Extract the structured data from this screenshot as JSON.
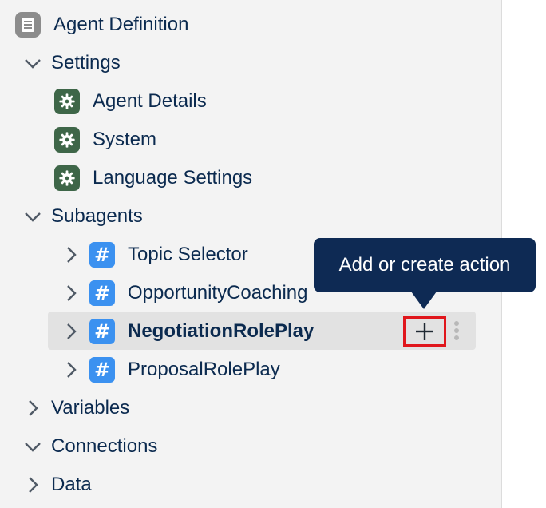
{
  "tree": {
    "agent_definition": "Agent Definition",
    "settings": {
      "label": "Settings",
      "items": [
        {
          "label": "Agent Details"
        },
        {
          "label": "System"
        },
        {
          "label": "Language Settings"
        }
      ]
    },
    "subagents": {
      "label": "Subagents",
      "items": [
        {
          "label": "Topic Selector"
        },
        {
          "label": "OpportunityCoaching"
        },
        {
          "label": "NegotiationRolePlay"
        },
        {
          "label": "ProposalRolePlay"
        }
      ]
    },
    "variables": "Variables",
    "connections": "Connections",
    "data": "Data"
  },
  "tooltip": {
    "text": "Add or create action"
  },
  "colors": {
    "text": "#0b2a4f",
    "gear_bg": "#3e6648",
    "hash_bg": "#3b91f0",
    "tooltip_bg": "#0e2a54",
    "highlight": "#e0161c"
  },
  "icons": {
    "subagent_glyph": "#"
  }
}
